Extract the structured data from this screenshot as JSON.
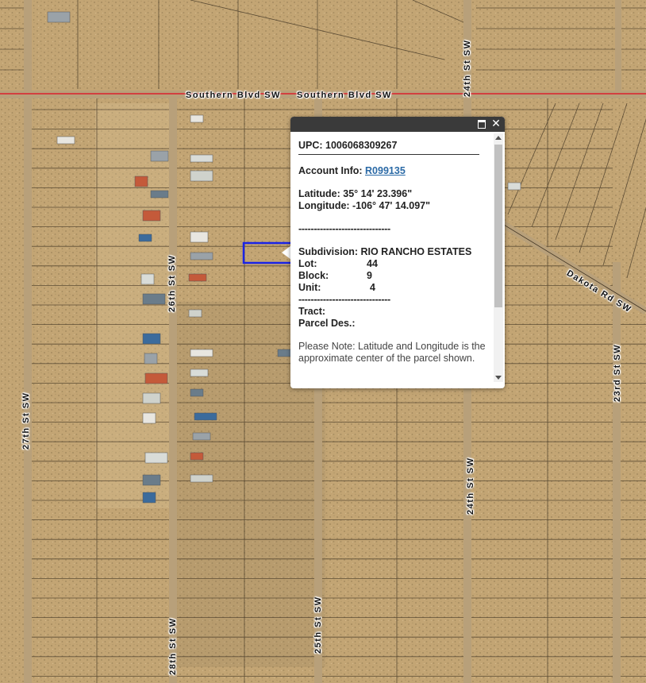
{
  "map": {
    "streets": {
      "southern_blvd_label": "Southern Blvd SW",
      "dakota_rd_label": "Dakota Rd SW",
      "st_24th_label": "24th St SW",
      "st_25th_label": "25th St SW",
      "st_26th_label": "26th St SW",
      "st_27th_label": "27th St SW",
      "st_28th_label": "28th St SW",
      "st_23rd_label": "23rd St SW"
    },
    "colors": {
      "ground": "#c5a878",
      "parcel_line": "#3c3020",
      "road": "#b59e78",
      "highlight": "#1a24e6",
      "road_red": "#d24040"
    }
  },
  "popup": {
    "upc": "UPC: 1006068309267",
    "account_label": "Account Info:",
    "account_link": "R099135",
    "latitude": "Latitude: 35° 14' 23.396\"",
    "longitude": "Longitude: -106° 47' 14.097\"",
    "dashes": "------------------------------",
    "subdivision": "Subdivision: RIO RANCHO ESTATES",
    "lot_label": "Lot:",
    "lot_value": "44",
    "block_label": "Block:",
    "block_value": "9",
    "unit_label": "Unit:",
    "unit_value": "4",
    "dashes2": "------------------------------",
    "tract_label": "Tract:",
    "parcel_label": "Parcel Des.:",
    "note": "Please Note: Latitude and Longitude is the approximate center of the parcel shown."
  }
}
